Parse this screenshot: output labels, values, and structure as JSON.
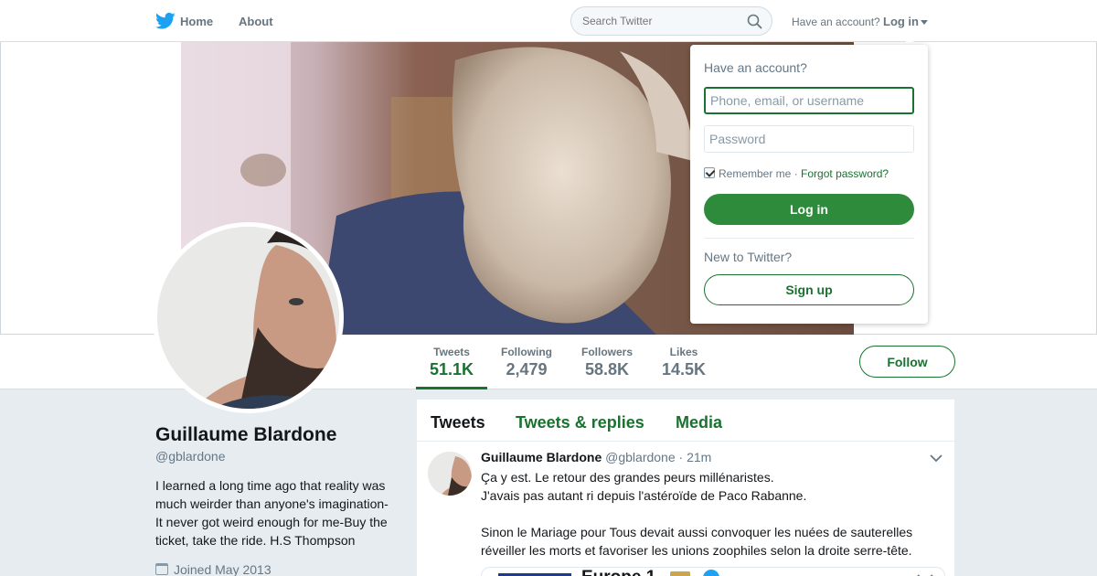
{
  "nav": {
    "logo_icon": "twitter-bird-icon",
    "home_label": "Home",
    "about_label": "About",
    "search_placeholder": "Search Twitter",
    "search_icon": "search-icon",
    "have_account_text": "Have an account?",
    "login_label": "Log in",
    "brand_color": "#1da1f2"
  },
  "profile": {
    "name": "Guillaume Blardone",
    "handle": "@gblardone",
    "bio": "I learned a long time ago that reality was much weirder than anyone's imagination-It never got weird enough for me-Buy the ticket, take the ride. H.S Thompson",
    "joined": "Joined May 2013",
    "accent_color": "#19722f"
  },
  "stats": [
    {
      "label": "Tweets",
      "value": "51.1K",
      "active": true
    },
    {
      "label": "Following",
      "value": "2,479",
      "active": false
    },
    {
      "label": "Followers",
      "value": "58.8K",
      "active": false
    },
    {
      "label": "Likes",
      "value": "14.5K",
      "active": false
    }
  ],
  "follow_label": "Follow",
  "timeline": {
    "tabs": [
      {
        "label": "Tweets",
        "active": true
      },
      {
        "label": "Tweets & replies",
        "active": false
      },
      {
        "label": "Media",
        "active": false
      }
    ],
    "tweet": {
      "name": "Guillaume Blardone",
      "handle": "@gblardone",
      "separator": "·",
      "time": "21m",
      "lines": [
        "Ça y est. Le retour des grandes peurs millénaristes.",
        "J'avais pas autant ri depuis l'astéroïde de Paco Rabanne.",
        "",
        "Sinon le Mariage pour Tous devait aussi convoquer les nuées de sauterelles réveiller les morts et favoriser les unions zoophiles selon la droite serre-tête."
      ],
      "card_title": "Europe 1"
    }
  },
  "login_dropdown": {
    "heading": "Have an account?",
    "username_placeholder": "Phone, email, or username",
    "password_placeholder": "Password",
    "remember_label": "Remember me",
    "remember_checked": true,
    "separator": "·",
    "forgot_label": "Forgot password?",
    "login_button": "Log in",
    "new_text": "New to Twitter?",
    "signup_button": "Sign up",
    "button_color": "#2e8b3c"
  }
}
